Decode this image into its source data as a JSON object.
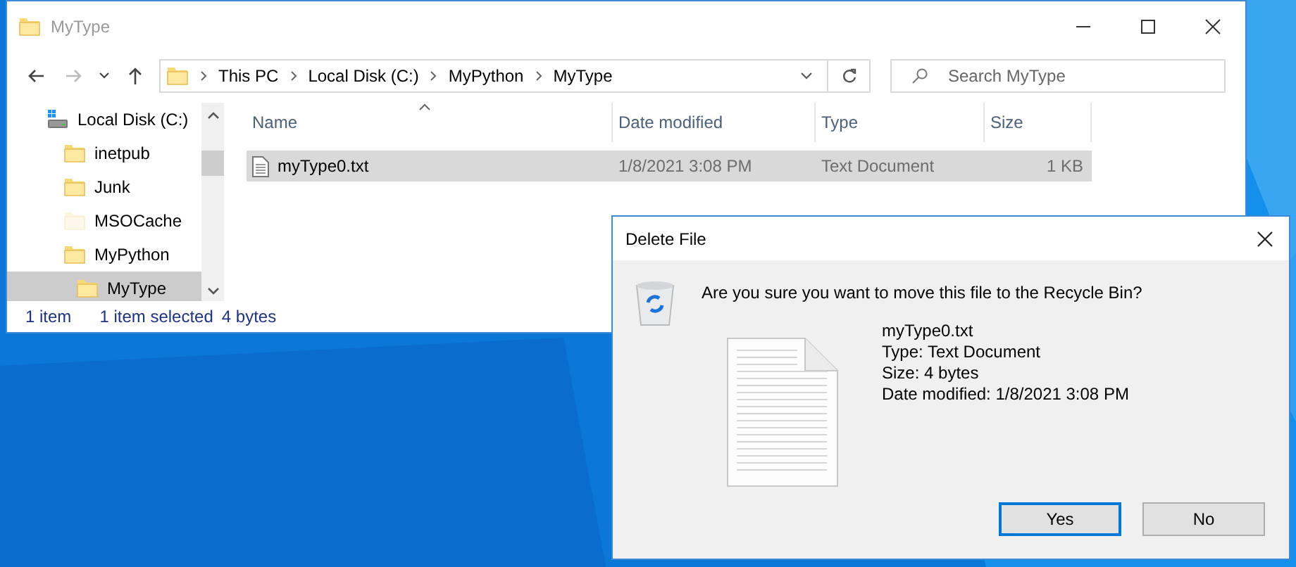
{
  "explorer": {
    "title": "MyType",
    "nav_buttons": [
      {
        "kind": "back",
        "disabled": false
      },
      {
        "kind": "forward",
        "disabled": true
      },
      {
        "kind": "recent",
        "disabled": false
      },
      {
        "kind": "up",
        "disabled": false
      }
    ],
    "address": [
      "This PC",
      "Local Disk (C:)",
      "MyPython",
      "MyType"
    ],
    "search": {
      "placeholder": "Search MyType"
    },
    "sidebar": {
      "items": [
        {
          "label": "Local Disk (C:)",
          "kind": "drive",
          "hidden": false,
          "selected": false,
          "children": [
            {
              "label": "inetpub",
              "kind": "folder",
              "hidden": false,
              "selected": false
            },
            {
              "label": "Junk",
              "kind": "folder",
              "hidden": false,
              "selected": false
            },
            {
              "label": "MSOCache",
              "kind": "folder",
              "hidden": true,
              "selected": false
            },
            {
              "label": "MyPython",
              "kind": "folder",
              "hidden": false,
              "selected": false,
              "children": [
                {
                  "label": "MyType",
                  "kind": "folder",
                  "hidden": false,
                  "selected": true
                }
              ]
            }
          ]
        }
      ]
    },
    "table": {
      "columns": [
        {
          "label": "Name",
          "sorted": true
        },
        {
          "label": "Date modified",
          "sorted": false
        },
        {
          "label": "Type",
          "sorted": false
        },
        {
          "label": "Size",
          "sorted": false
        }
      ],
      "rows": [
        {
          "name": "myType0.txt",
          "date": "1/8/2021 3:08 PM",
          "type": "Text Document",
          "size": "1 KB",
          "selected": true
        }
      ]
    },
    "status_bar": [
      "1 item",
      "1 item selected",
      "4 bytes"
    ]
  },
  "dialog": {
    "title": "Delete File",
    "question": "Are you sure you want to move this file to the Recycle Bin?",
    "details": [
      "myType0.txt",
      "Type: Text Document",
      "Size: 4 bytes",
      "Date modified: 1/8/2021 3:08 PM"
    ],
    "buttons": [
      {
        "label": "Yes",
        "default": true
      },
      {
        "label": "No",
        "default": false
      }
    ]
  }
}
